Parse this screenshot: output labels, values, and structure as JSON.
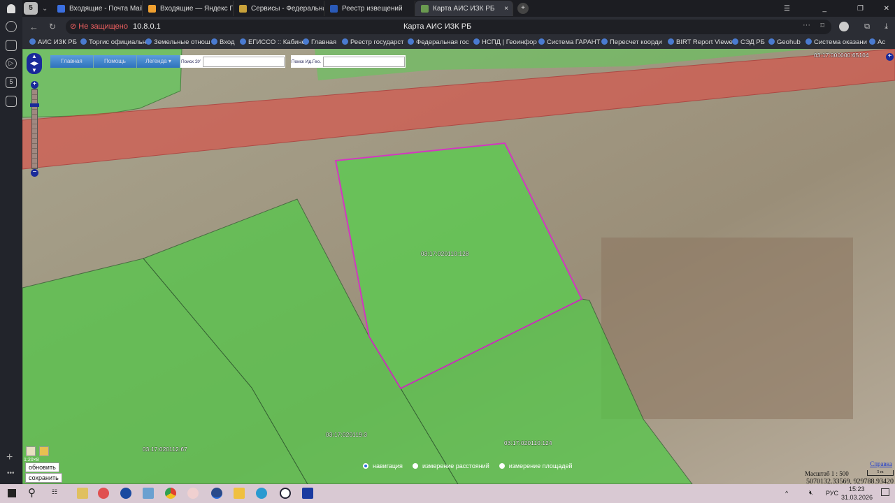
{
  "browser": {
    "tabs": [
      {
        "label": "Входящие - Почта Mail",
        "color": "#3b6fe0"
      },
      {
        "label": "Входящие — Яндекс Почта",
        "color": "#f0a030"
      },
      {
        "label": "Сервисы - Федеральная с",
        "color": "#c9a23a"
      },
      {
        "label": "Реестр извещений",
        "color": "#2a5ab8"
      },
      {
        "label": "Карта АИС ИЗК РБ",
        "color": "#6a9a50"
      }
    ],
    "tab_count": "5",
    "security": "Не защищено",
    "url": "10.8.0.1",
    "page_title": "Карта АИС ИЗК РБ",
    "bookmarks": [
      "АИС ИЗК РБ",
      "Торгис официальн",
      "Земельные отнош",
      "Вход",
      "ЕГИССО :: Кабинет",
      "Главная",
      "Реестр государст",
      "Федеральная гос",
      "НСПД | Геоинфор",
      "Система ГАРАНТ",
      "Пересчет коорди",
      "BIRT Report Viewer",
      "СЭД РБ",
      "Geohub",
      "Система оказани",
      "Ас"
    ]
  },
  "map": {
    "toolbar": {
      "home": "Главная",
      "help": "Помощь",
      "legend": "Легенда",
      "search_zu_label": "Поиск ЗУ",
      "search_zu_value": "",
      "search_geo_label": "Поиск Ид.Гео.",
      "search_geo_value": ""
    },
    "parcels": [
      "03:17:020110:128",
      "03:17:020112:67",
      "03:17:020119:3",
      "03:17:020110:124",
      "03:17:000000:65104"
    ],
    "modes": [
      "навигация",
      "измерение расстояний",
      "измерение площадей"
    ],
    "selected_mode": 0,
    "buttons": {
      "refresh": "обновить",
      "save": "сохранить"
    },
    "scale_small": "1:20×8",
    "help_link": "Справка",
    "scale": "Масштаб 1 : 500",
    "scalebar": "5 m",
    "coords": "5070132.33569, 929788.93420"
  },
  "taskbar": {
    "lang": "РУС",
    "time": "15:23",
    "date": "31.03.2026"
  }
}
